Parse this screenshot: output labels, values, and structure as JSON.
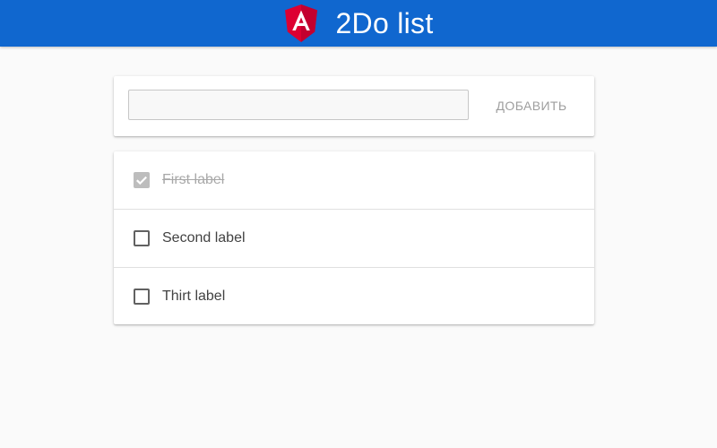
{
  "header": {
    "title": "2Do list",
    "logo_icon": "angular-logo-icon",
    "logo_letter": "A",
    "background": "#1067cf",
    "logo_color": "#dd0031"
  },
  "add_form": {
    "input_value": "",
    "input_placeholder": "",
    "add_button_label": "ДОБАВИТЬ"
  },
  "todos": [
    {
      "label": "First label",
      "checked": true
    },
    {
      "label": "Second label",
      "checked": false
    },
    {
      "label": "Thirt label",
      "checked": false
    }
  ]
}
